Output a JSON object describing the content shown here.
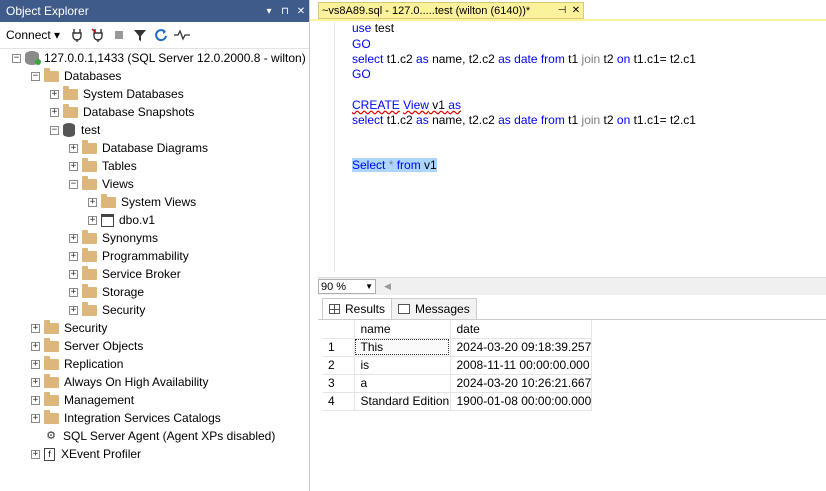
{
  "object_explorer": {
    "title": "Object Explorer",
    "title_controls": [
      "▾",
      "⊓",
      "✕"
    ],
    "connect_label": "Connect ▾",
    "tree": [
      {
        "label": "127.0.0.1,1433 (SQL Server 12.0.2000.8 - wilton)",
        "level": 0,
        "exp": "−",
        "icon": "server-icon"
      },
      {
        "label": "Databases",
        "level": 1,
        "exp": "−",
        "icon": "folder-icon"
      },
      {
        "label": "System Databases",
        "level": 2,
        "exp": "+",
        "icon": "folder-icon"
      },
      {
        "label": "Database Snapshots",
        "level": 2,
        "exp": "+",
        "icon": "folder-icon"
      },
      {
        "label": "test",
        "level": 2,
        "exp": "−",
        "icon": "database-icon"
      },
      {
        "label": "Database Diagrams",
        "level": 3,
        "exp": "+",
        "icon": "folder-icon"
      },
      {
        "label": "Tables",
        "level": 3,
        "exp": "+",
        "icon": "folder-icon"
      },
      {
        "label": "Views",
        "level": 3,
        "exp": "−",
        "icon": "folder-icon"
      },
      {
        "label": "System Views",
        "level": 4,
        "exp": "+",
        "icon": "folder-icon"
      },
      {
        "label": "dbo.v1",
        "level": 4,
        "exp": "+",
        "icon": "view-icon"
      },
      {
        "label": "Synonyms",
        "level": 3,
        "exp": "+",
        "icon": "folder-icon"
      },
      {
        "label": "Programmability",
        "level": 3,
        "exp": "+",
        "icon": "folder-icon"
      },
      {
        "label": "Service Broker",
        "level": 3,
        "exp": "+",
        "icon": "folder-icon"
      },
      {
        "label": "Storage",
        "level": 3,
        "exp": "+",
        "icon": "folder-icon"
      },
      {
        "label": "Security",
        "level": 3,
        "exp": "+",
        "icon": "folder-icon"
      },
      {
        "label": "Security",
        "level": 1,
        "exp": "+",
        "icon": "folder-icon"
      },
      {
        "label": "Server Objects",
        "level": 1,
        "exp": "+",
        "icon": "folder-icon"
      },
      {
        "label": "Replication",
        "level": 1,
        "exp": "+",
        "icon": "folder-icon"
      },
      {
        "label": "Always On High Availability",
        "level": 1,
        "exp": "+",
        "icon": "folder-icon"
      },
      {
        "label": "Management",
        "level": 1,
        "exp": "+",
        "icon": "folder-icon"
      },
      {
        "label": "Integration Services Catalogs",
        "level": 1,
        "exp": "+",
        "icon": "folder-icon"
      },
      {
        "label": "SQL Server Agent (Agent XPs disabled)",
        "level": 1,
        "exp": "",
        "icon": "agent-icon"
      },
      {
        "label": "XEvent Profiler",
        "level": 1,
        "exp": "+",
        "icon": "xevent-icon"
      }
    ]
  },
  "editor": {
    "tab_title": "~vs8A89.sql - 127.0.....test (wilton (6140))*",
    "tab_controls": [
      "⊣",
      "✕"
    ],
    "code": {
      "l1_kw": "use",
      "l1_rest": " test",
      "l2": "GO",
      "l3_select": "select",
      "l3_a": " t1.c2 ",
      "l3_as": "as",
      "l3_b": " name, t2.c2 ",
      "l3_as2": "as",
      "l3_c": " ",
      "l3_date": "date",
      "l3_d": " ",
      "l3_from": "from",
      "l3_e": " t1 ",
      "l3_join": "join",
      "l3_f": " t2 ",
      "l3_on": "on",
      "l3_g": " t1.c1= t2.c1",
      "l4": "GO",
      "l5_create": "CREATE",
      "l5_view": "View",
      "l5_rest": " v1 ",
      "l5_as": "as",
      "l6_select": "select",
      "l6_a": " t1.c2 ",
      "l6_as": "as",
      "l6_b": " name, t2.c2 ",
      "l6_as2": "as",
      "l6_c": " ",
      "l6_date": "date",
      "l6_d": " ",
      "l6_from": "from",
      "l6_e": " t1 ",
      "l6_join": "join",
      "l6_f": " t2 ",
      "l6_on": "on",
      "l6_g": " t1.c1= t2.c1",
      "l7_select": "Select",
      "l7_star": " * ",
      "l7_from": "from",
      "l7_rest": " v1"
    }
  },
  "zoom": {
    "value": "90 %"
  },
  "results": {
    "tabs": {
      "results": "Results",
      "messages": "Messages"
    },
    "columns": [
      "name",
      "date"
    ],
    "rows": [
      {
        "n": "1",
        "name": "This",
        "date": "2024-03-20 09:18:39.257"
      },
      {
        "n": "2",
        "name": "is",
        "date": "2008-11-11 00:00:00.000"
      },
      {
        "n": "3",
        "name": "a",
        "date": "2024-03-20 10:26:21.667"
      },
      {
        "n": "4",
        "name": "Standard Edition",
        "date": "1900-01-08 00:00:00.000"
      }
    ]
  }
}
